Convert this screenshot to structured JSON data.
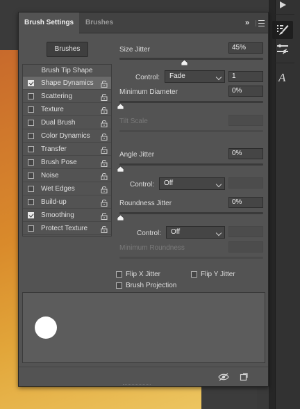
{
  "panel": {
    "tabs": [
      {
        "label": "Brush Settings",
        "active": true
      },
      {
        "label": "Brushes",
        "active": false
      }
    ],
    "collapse_glyph": "»",
    "brushes_button": "Brushes"
  },
  "tip_list": {
    "header": "Brush Tip Shape",
    "items": [
      {
        "label": "Shape Dynamics",
        "checked": true,
        "selected": true
      },
      {
        "label": "Scattering",
        "checked": false
      },
      {
        "label": "Texture",
        "checked": false
      },
      {
        "label": "Dual Brush",
        "checked": false
      },
      {
        "label": "Color Dynamics",
        "checked": false
      },
      {
        "label": "Transfer",
        "checked": false
      },
      {
        "label": "Brush Pose",
        "checked": false
      },
      {
        "label": "Noise",
        "checked": false
      },
      {
        "label": "Wet Edges",
        "checked": false
      },
      {
        "label": "Build-up",
        "checked": false
      },
      {
        "label": "Smoothing",
        "checked": true
      },
      {
        "label": "Protect Texture",
        "checked": false
      }
    ]
  },
  "controls": {
    "size_jitter": {
      "label": "Size Jitter",
      "value": "45%"
    },
    "size_control": {
      "label": "Control:",
      "selected": "Fade",
      "steps": "1"
    },
    "min_diameter": {
      "label": "Minimum Diameter",
      "value": "0%"
    },
    "tilt_scale": {
      "label": "Tilt Scale",
      "value": ""
    },
    "angle_jitter": {
      "label": "Angle Jitter",
      "value": "0%"
    },
    "angle_control": {
      "label": "Control:",
      "selected": "Off"
    },
    "roundness_jitter": {
      "label": "Roundness Jitter",
      "value": "0%"
    },
    "roundness_control": {
      "label": "Control:",
      "selected": "Off"
    },
    "min_roundness": {
      "label": "Minimum Roundness",
      "value": ""
    },
    "flip_x": {
      "label": "Flip X Jitter",
      "checked": false
    },
    "flip_y": {
      "label": "Flip Y Jitter",
      "checked": false
    },
    "brush_projection": {
      "label": "Brush Projection",
      "checked": false
    }
  },
  "icons": {
    "toolbar_right": [
      "play-icon",
      "brush-settings-icon",
      "brush-presets-icon",
      "character-icon"
    ],
    "footer": [
      "toggle-preview-icon",
      "new-brush-icon"
    ]
  },
  "colors": {
    "panel_bg": "#535353",
    "tab_bg": "#424242",
    "canvas_orange": "#d27c2c",
    "canvas_yellow": "#ecc560"
  }
}
